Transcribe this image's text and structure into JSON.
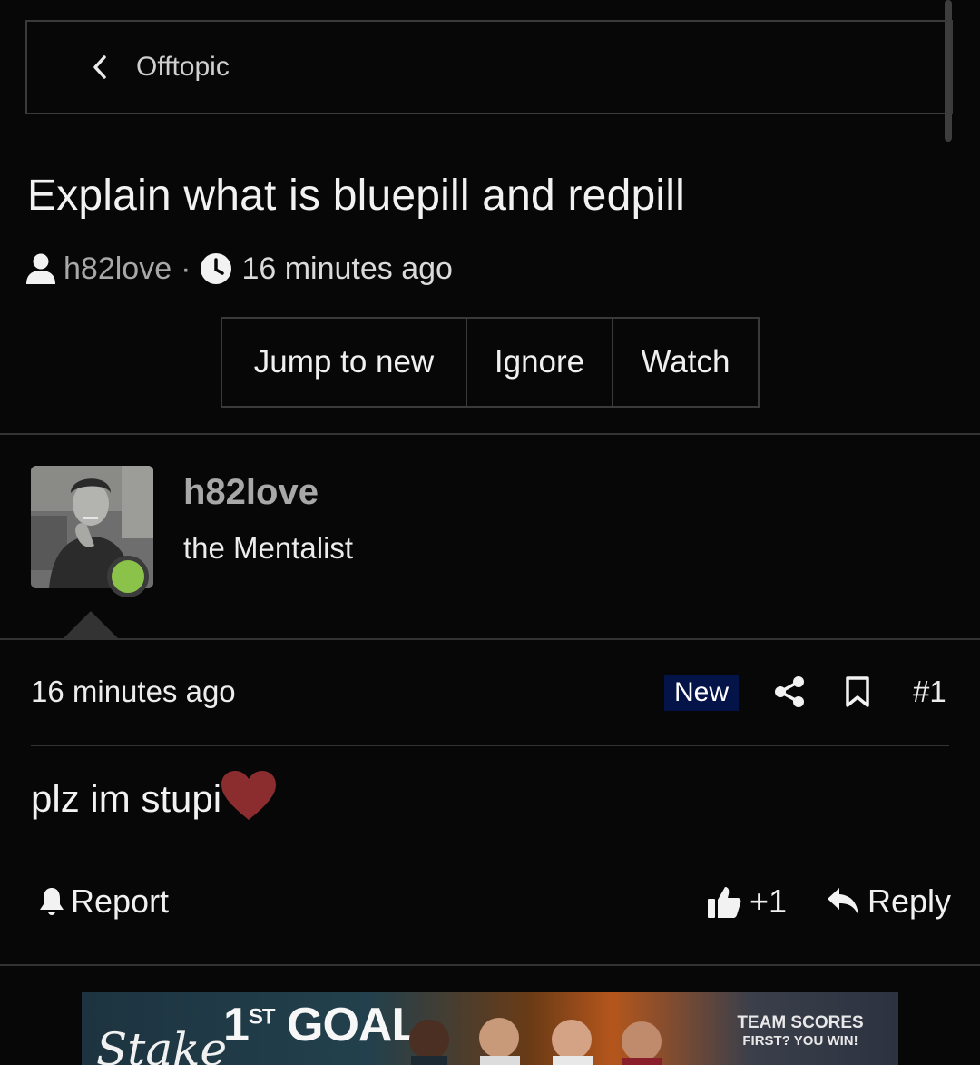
{
  "breadcrumb": {
    "label": "Offtopic"
  },
  "thread": {
    "title": "Explain what is bluepill and redpill",
    "author": "h82love",
    "separator": "·",
    "time": "16 minutes ago"
  },
  "actions": {
    "jump_label": "Jump to new",
    "ignore_label": "Ignore",
    "watch_label": "Watch"
  },
  "post": {
    "author": "h82love",
    "user_title": "the Mentalist",
    "time": "16 minutes ago",
    "badge": "New",
    "number": "#1",
    "body": "plz im stupi",
    "report_label": "Report",
    "like_count": "+1",
    "reply_label": "Reply"
  },
  "ad": {
    "brand": "Stake",
    "headline": "1",
    "headline_sup": "ST",
    "headline_rest": " GOAL",
    "tagline_1": "TEAM SCORES",
    "tagline_2": "FIRST? YOU WIN!"
  },
  "colors": {
    "background": "#070707",
    "badge_bg": "#041449",
    "online": "#8bc34a",
    "heart": "#8b2c2e"
  },
  "icons": [
    "chevron-left-icon",
    "user-icon",
    "clock-icon",
    "share-icon",
    "bookmark-icon",
    "heart-icon",
    "bell-icon",
    "thumbs-up-icon",
    "reply-icon"
  ]
}
